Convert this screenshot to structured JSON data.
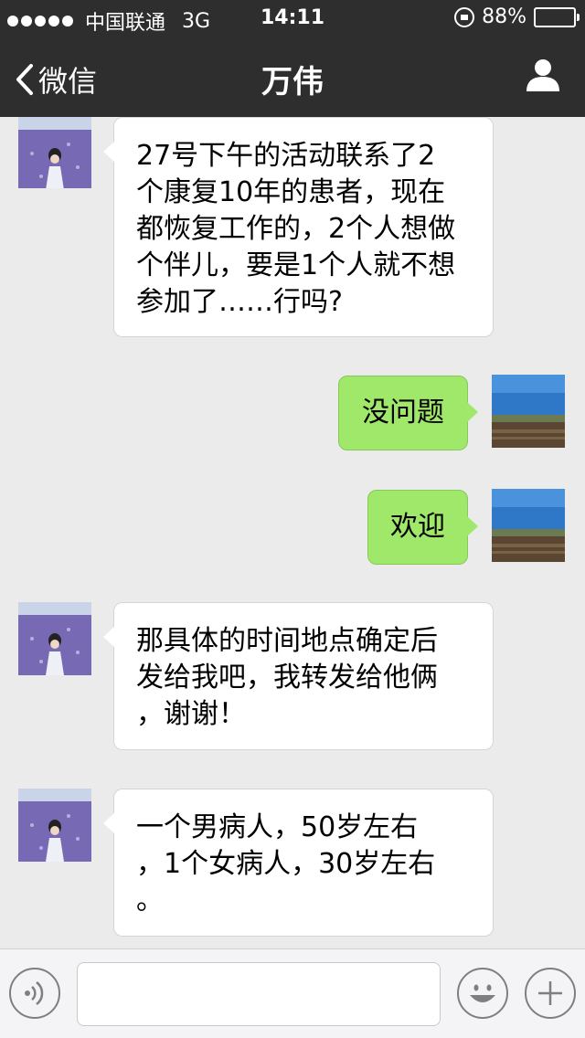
{
  "status_bar": {
    "carrier": "中国联通",
    "network": "3G",
    "time": "14:11",
    "battery_text": "88%",
    "battery_level": 0.88
  },
  "nav": {
    "back_label": "微信",
    "title": "万伟"
  },
  "messages": [
    {
      "side": "left",
      "lines": [
        "27号下午的活动联系了2",
        "个康复10年的患者，现在",
        "都恢复工作的，2个人想做",
        "个伴儿，要是1个人就不想",
        "参加了……行吗?"
      ]
    },
    {
      "side": "right",
      "text": "没问题"
    },
    {
      "side": "right",
      "text": "欢迎"
    },
    {
      "side": "left",
      "lines": [
        "那具体的时间地点确定后",
        "发给我吧，我转发给他俩",
        "，谢谢！"
      ]
    },
    {
      "side": "left",
      "lines": [
        "一个男病人，50岁左右",
        "，1个女病人，30岁左右",
        "。"
      ]
    }
  ],
  "colors": {
    "bar_dark": "#2e2e2e",
    "chat_bg": "#ebebeb",
    "sent_bubble": "#9fe86a",
    "received_bubble": "#ffffff"
  },
  "icons": {
    "back": "chevron-left-icon",
    "profile": "person-icon",
    "voice": "voice-icon",
    "emoji": "smiley-icon",
    "more": "plus-icon"
  }
}
